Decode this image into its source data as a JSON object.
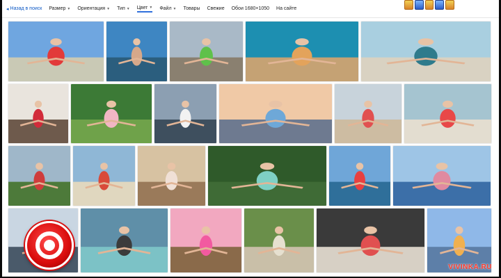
{
  "toolbar": {
    "back_label": "Назад в поиск",
    "items": [
      {
        "label": "Размер",
        "arrow": "▼"
      },
      {
        "label": "Ориентация",
        "arrow": "▼"
      },
      {
        "label": "Тип",
        "arrow": "▼"
      },
      {
        "label": "Цвет",
        "arrow": "▼"
      },
      {
        "label": "Файл",
        "arrow": "▼"
      },
      {
        "label": "Товары",
        "arrow": ""
      },
      {
        "label": "Свежие",
        "arrow": ""
      },
      {
        "label": "Обои 1680×1050",
        "arrow": ""
      },
      {
        "label": "На сайте",
        "arrow": ""
      }
    ]
  },
  "images": [
    {
      "sky": "#6fa6e0",
      "ground": "#c9c9b5",
      "accent": "#e23a3a"
    },
    {
      "sky": "#3e86c2",
      "ground": "#2b5e7e",
      "accent": "#d6a88a"
    },
    {
      "sky": "#a9b9c7",
      "ground": "#8a8070",
      "accent": "#5fc14a"
    },
    {
      "sky": "#1d8fb1",
      "ground": "#c5a274",
      "accent": "#e3a35b"
    },
    {
      "sky": "#a9cfe0",
      "ground": "#d9d2c2",
      "accent": "#2f7b8c"
    },
    {
      "sky": "#e9e4dd",
      "ground": "#6e5a4c",
      "accent": "#d22b3a"
    },
    {
      "sky": "#3c7a36",
      "ground": "#6fa24a",
      "accent": "#f1b6c4"
    },
    {
      "sky": "#8c9fb2",
      "ground": "#3e4f5e",
      "accent": "#f2f2f2"
    },
    {
      "sky": "#f0c9a6",
      "ground": "#6e7a90",
      "accent": "#6ea8d8"
    },
    {
      "sky": "#c8d3db",
      "ground": "#cdbca2",
      "accent": "#e15050"
    },
    {
      "sky": "#a5c4d0",
      "ground": "#e3ddd0",
      "accent": "#e84848"
    },
    {
      "sky": "#9fb7c9",
      "ground": "#4d7a3a",
      "accent": "#cf3c3c"
    },
    {
      "sky": "#8fb7d6",
      "ground": "#e0d7bf",
      "accent": "#d94a3a"
    },
    {
      "sky": "#d7c2a2",
      "ground": "#9a7a5a",
      "accent": "#f0e0d6"
    },
    {
      "sky": "#2f5a2a",
      "ground": "#3f6b36",
      "accent": "#7fd0c5"
    },
    {
      "sky": "#6fa6d8",
      "ground": "#2f6f9a",
      "accent": "#e84040"
    },
    {
      "sky": "#9ec5e6",
      "ground": "#3c6fa8",
      "accent": "#e08aa0"
    },
    {
      "sky": "#c9d6e2",
      "ground": "#4a5a6a",
      "accent": "#c94040"
    },
    {
      "sky": "#5f8fa8",
      "ground": "#7cc2c6",
      "accent": "#3b3b3b"
    },
    {
      "sky": "#f2a8c0",
      "ground": "#8a6a4a",
      "accent": "#f25aa0"
    },
    {
      "sky": "#6a8f4a",
      "ground": "#c9bfa8",
      "accent": "#e6e0d0"
    },
    {
      "sky": "#3a3a3a",
      "ground": "#d7d0c5",
      "accent": "#e05050"
    },
    {
      "sky": "#8fb8e8",
      "ground": "#5d7fa8",
      "accent": "#f0b050"
    }
  ],
  "record_button": {
    "color": "#d90c0c"
  },
  "watermark": "VIVINKA.RU"
}
